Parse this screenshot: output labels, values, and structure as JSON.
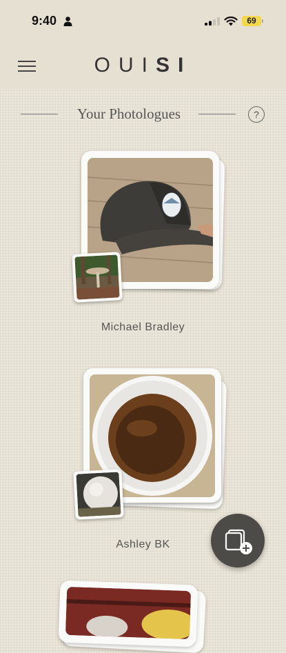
{
  "status_bar": {
    "time": "9:40",
    "battery": "69",
    "icons": [
      "person-icon",
      "signal-icon",
      "wifi-icon",
      "battery-icon"
    ],
    "battery_color": "#f3d84b"
  },
  "header": {
    "logo_light": "OUI",
    "logo_bold": "SI",
    "menu_icon": "hamburger-menu-icon"
  },
  "section": {
    "title": "Your Photologues",
    "help_label": "?"
  },
  "photologues": [
    {
      "name": "Michael Bradley",
      "main_photo": "cap photo",
      "thumb_photo": "mushroom photo"
    },
    {
      "name": "Ashley BK",
      "main_photo": "espresso cup photo",
      "thumb_photo": "puffball photo"
    },
    {
      "name": "",
      "main_photo": "partial photo",
      "thumb_photo": ""
    }
  ],
  "fab": {
    "icon": "add-photos-icon"
  },
  "colors": {
    "background": "#ebe6da",
    "header": "#e6e0d3",
    "fab": "#4d4b48"
  }
}
